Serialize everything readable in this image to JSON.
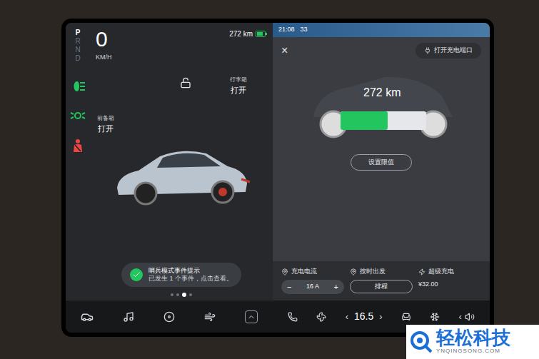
{
  "gear_selector": [
    {
      "label": "P",
      "selected": true
    },
    {
      "label": "R",
      "selected": false
    },
    {
      "label": "N",
      "selected": false
    },
    {
      "label": "D",
      "selected": false
    }
  ],
  "speed": {
    "value": "0",
    "unit": "KM/H"
  },
  "range": "272 km",
  "indicators": [
    {
      "kind": "headlight",
      "color": "#22c55e"
    },
    {
      "kind": "parking",
      "color": "#22c55e"
    },
    {
      "kind": "seatbelt",
      "color": "#ef4444"
    }
  ],
  "closures": [
    {
      "name": "前备箱",
      "state": "打开"
    },
    {
      "name": "行李箱",
      "state": "打开"
    }
  ],
  "lock": {
    "locked": false
  },
  "notification": {
    "title": "哨兵模式事件提示",
    "body": "已发生 1 个事件，点击查看。"
  },
  "page_dots": [
    {
      "selected": false
    },
    {
      "selected": false
    },
    {
      "selected": true
    },
    {
      "selected": false
    }
  ],
  "charging": {
    "status_time": "21:08",
    "status_temp": "33",
    "close": "×",
    "port_button": "打开充电端口",
    "range": "272 km",
    "level": 0.55,
    "limit_button": "设置限值",
    "current": {
      "label": "充电电流",
      "value": "16 A",
      "minus": "−",
      "plus": "+"
    },
    "departure": {
      "label": "按时出发",
      "button": "排程"
    },
    "supercharge": {
      "label": "超级充电",
      "price": "¥32.00"
    }
  },
  "climate": {
    "temp": "16.5",
    "left": "‹",
    "right": "›"
  },
  "volume": {
    "arrow": "‹"
  },
  "watermark": {
    "title": "轻松科技",
    "url": "YNQINGSONG.COM"
  }
}
